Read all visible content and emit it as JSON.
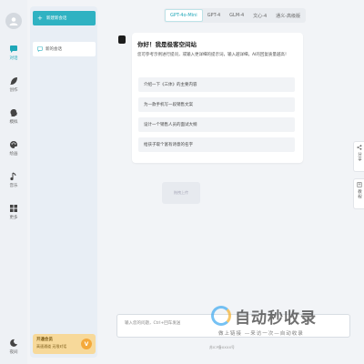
{
  "rail": {
    "items": [
      {
        "label": "对话",
        "icon": "chat-icon",
        "active": true
      },
      {
        "label": "创作",
        "icon": "feather-icon",
        "active": false
      },
      {
        "label": "模拟",
        "icon": "head-icon",
        "active": false
      },
      {
        "label": "绘画",
        "icon": "palette-icon",
        "active": false
      },
      {
        "label": "音乐",
        "icon": "music-icon",
        "active": false
      },
      {
        "label": "更多",
        "icon": "grid-icon",
        "active": false
      }
    ],
    "bottom_label": "夜间"
  },
  "sidebar": {
    "new_chat_label": "新建新会话",
    "sessions": [
      {
        "label": "新的会话"
      }
    ],
    "vip": {
      "title": "开通会员",
      "subtitle": "高速通道 无限对话",
      "badge": "V"
    }
  },
  "model_tabs": [
    "GPT-4o-Mini",
    "GPT-4",
    "GLM-4",
    "文心-4",
    "通义-高级版"
  ],
  "active_model": "GPT-4o-Mini",
  "welcome": {
    "title": "你好！我是极客空间站",
    "description": "您可参考示例进行提问，或输入更详细的提示词，输入越详细，AI的回复质量越高！",
    "prompts": [
      "介绍一下《三体》的主要内容",
      "为一款手机写一段销售文案",
      "设计一个销售人员的面试大纲",
      "给孩子取个富有诗意的名字"
    ]
  },
  "drag_ghost_text": "拖拽上传",
  "right_tabs": [
    {
      "label": "分享",
      "icon": "share-icon"
    },
    {
      "label": "教程",
      "icon": "book-icon"
    }
  ],
  "input": {
    "placeholder": "输入您的问题，Ctrl+回车发送"
  },
  "footer": "苏ICP备XXXX号",
  "watermark": {
    "text": "自动秒收录",
    "subtext": "做上链接 —来访一次—自动收录"
  },
  "colors": {
    "accent": "#2fb2c2",
    "vip": "#f7d99a"
  }
}
